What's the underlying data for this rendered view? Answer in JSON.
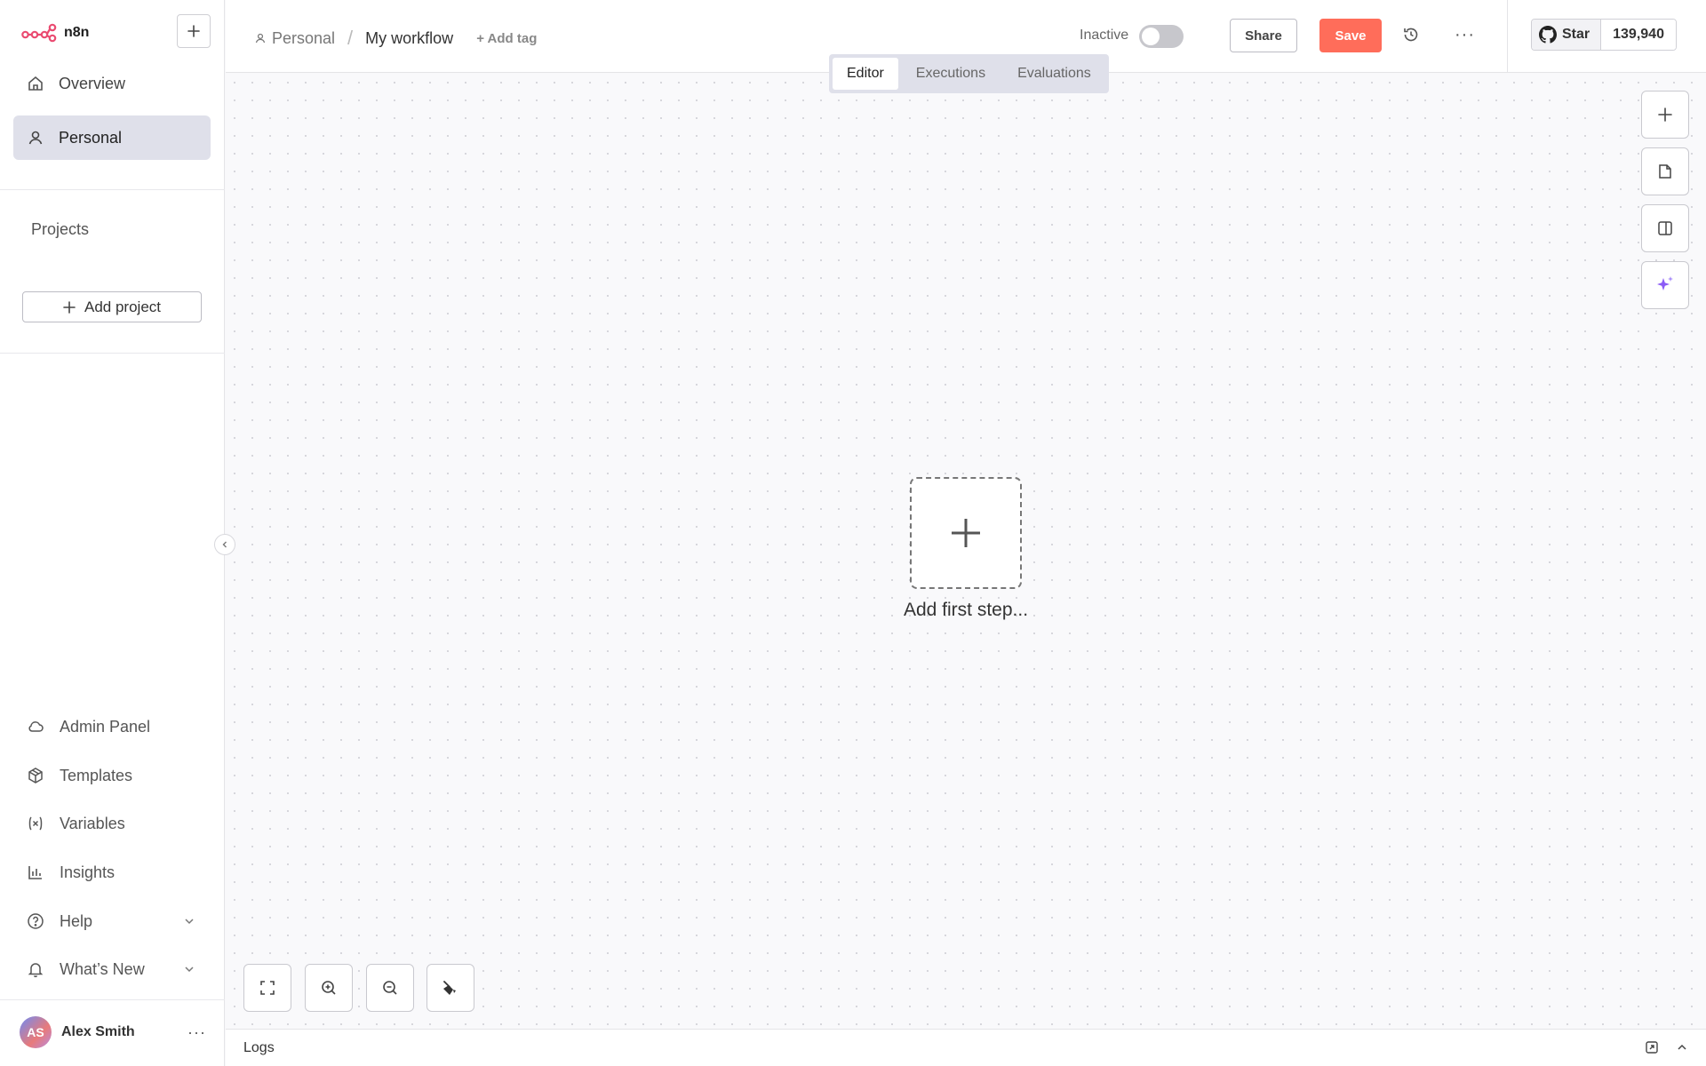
{
  "brand": {
    "name": "n8n",
    "accent": "#ff6d5a"
  },
  "sidebar": {
    "nav": [
      {
        "label": "Overview",
        "icon": "home-icon"
      },
      {
        "label": "Personal",
        "icon": "user-icon",
        "active": true
      }
    ],
    "projects_label": "Projects",
    "add_project_label": "Add project",
    "bottom": [
      {
        "label": "Admin Panel",
        "icon": "cloud-icon"
      },
      {
        "label": "Templates",
        "icon": "box-icon"
      },
      {
        "label": "Variables",
        "icon": "variables-icon"
      },
      {
        "label": "Insights",
        "icon": "chart-icon"
      },
      {
        "label": "Help",
        "icon": "help-icon"
      },
      {
        "label": "What’s New",
        "icon": "bell-icon"
      }
    ],
    "user": {
      "initials": "AS",
      "name": "Alex Smith"
    }
  },
  "header": {
    "breadcrumb_project": "Personal",
    "breadcrumb_separator": "/",
    "workflow_name": "My workflow",
    "add_tag_label": "+ Add tag",
    "status_label": "Inactive",
    "share_label": "Share",
    "save_label": "Save",
    "github_star_label": "Star",
    "github_star_count": "139,940"
  },
  "tabs": [
    {
      "label": "Editor",
      "active": true
    },
    {
      "label": "Executions"
    },
    {
      "label": "Evaluations"
    }
  ],
  "canvas": {
    "add_first_step_label": "Add first step..."
  },
  "logs": {
    "label": "Logs"
  }
}
